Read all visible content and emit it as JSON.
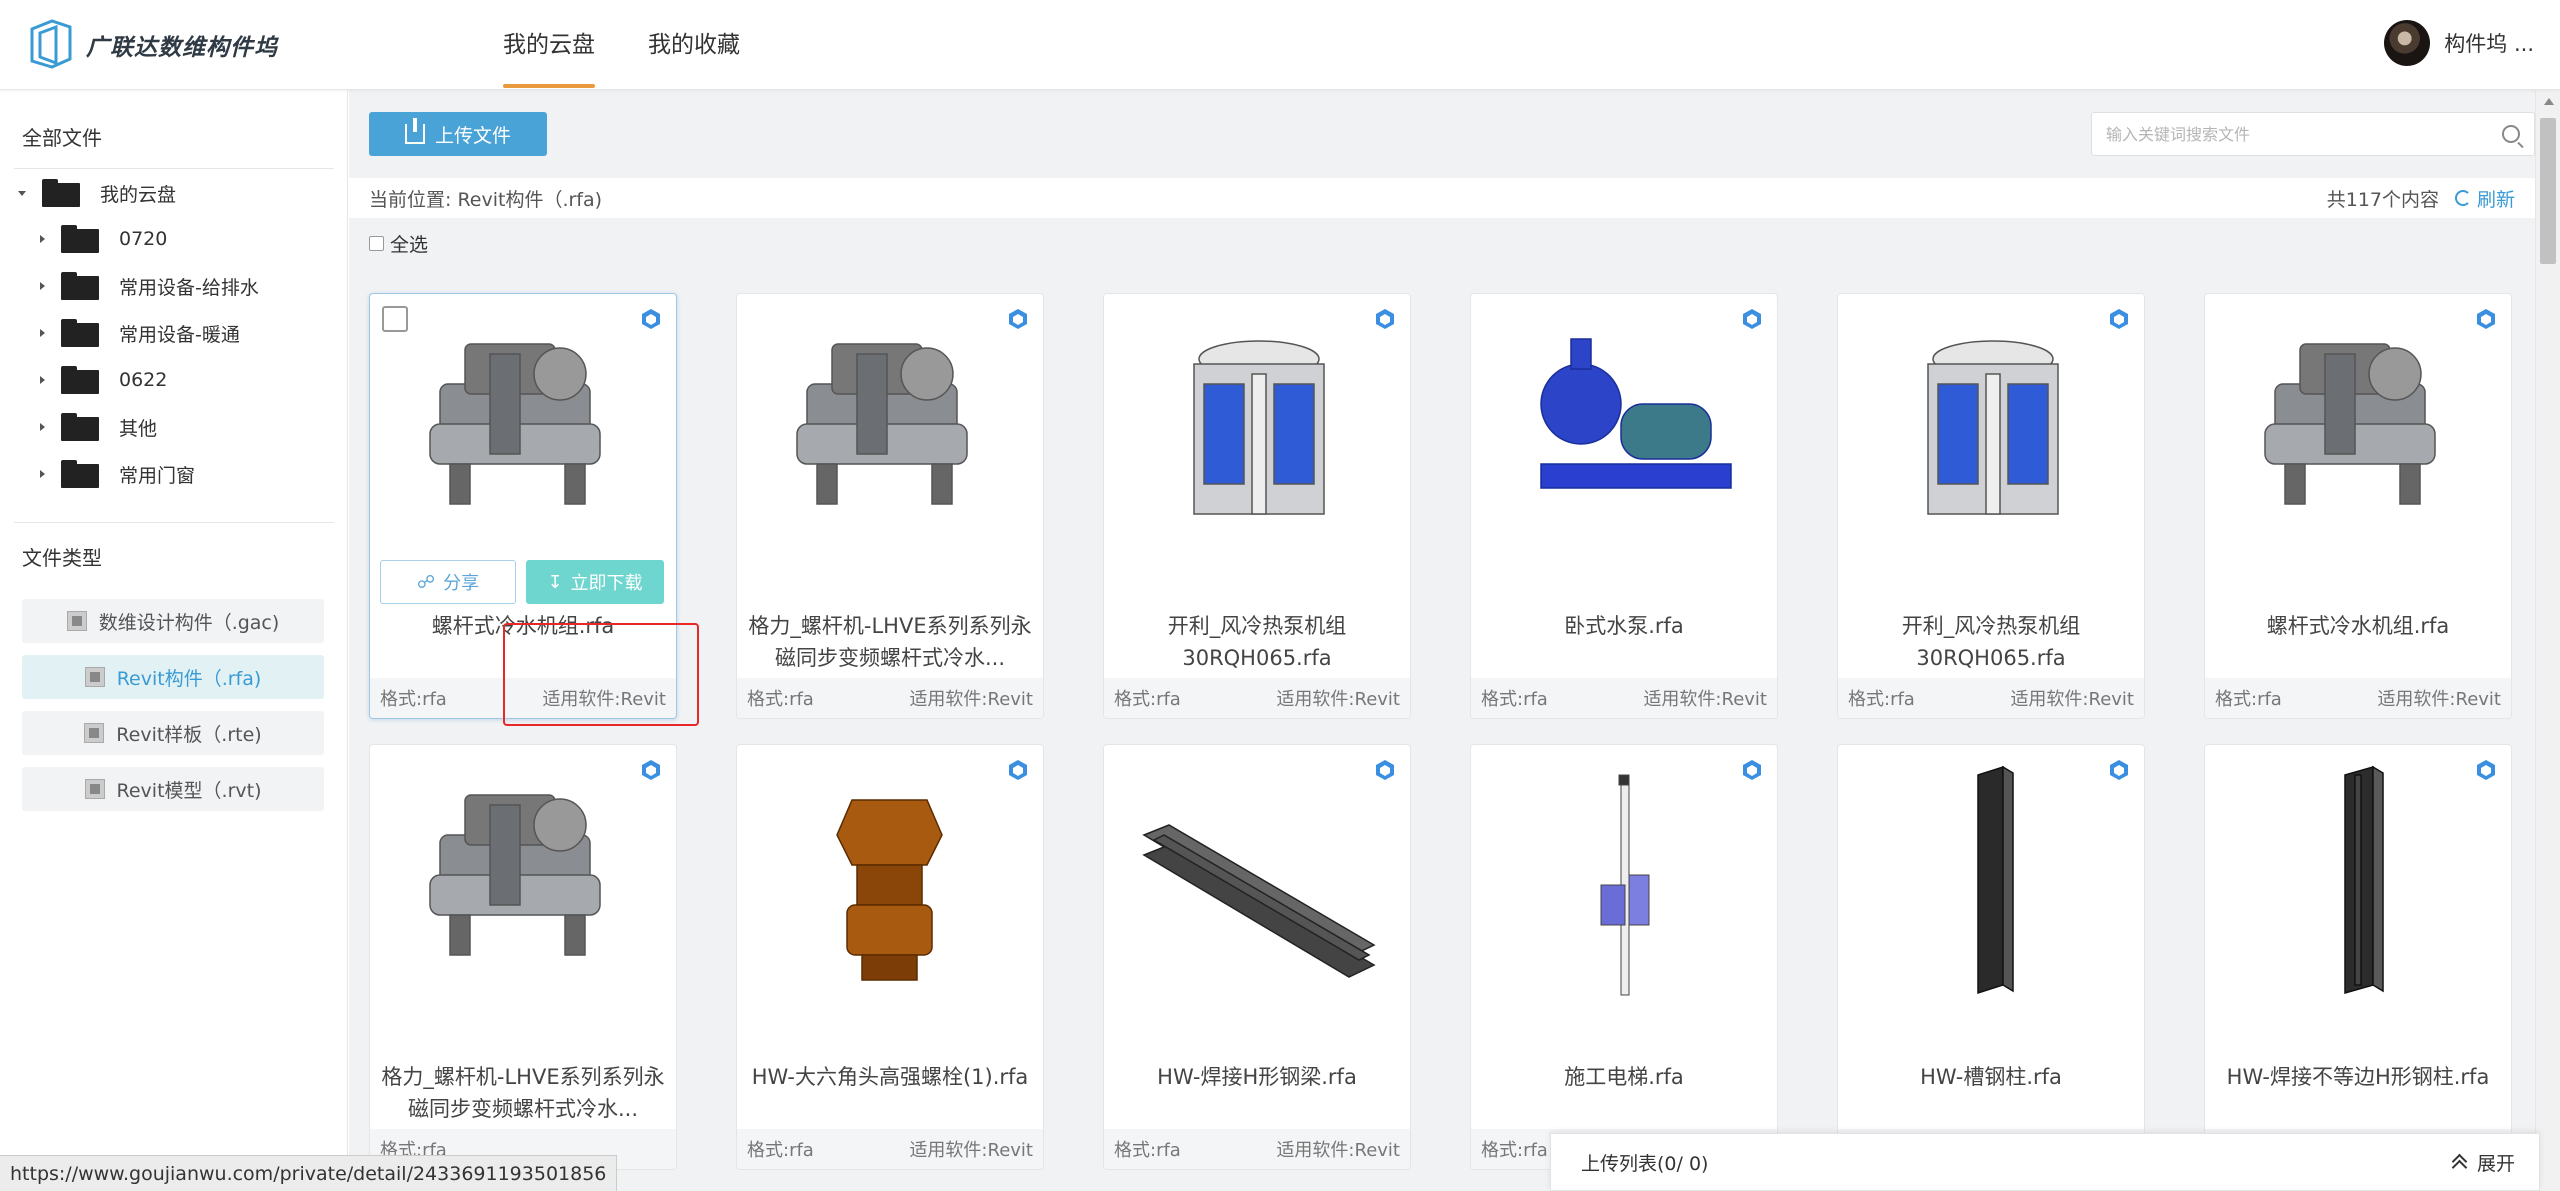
{
  "header": {
    "brand": "广联达数维构件坞",
    "tabs": [
      {
        "label": "我的云盘"
      },
      {
        "label": "我的收藏"
      }
    ],
    "user_name": "构件坞 ..."
  },
  "sidebar": {
    "all_files_title": "全部文件",
    "root": "我的云盘",
    "folders": [
      {
        "label": "0720"
      },
      {
        "label": "常用设备-给排水"
      },
      {
        "label": "常用设备-暖通"
      },
      {
        "label": "0622"
      },
      {
        "label": "其他"
      },
      {
        "label": "常用门窗"
      }
    ],
    "file_type_title": "文件类型",
    "types": [
      {
        "label": "数维设计构件（.gac)"
      },
      {
        "label": "Revit构件（.rfa)"
      },
      {
        "label": "Revit样板（.rte)"
      },
      {
        "label": "Revit模型（.rvt)"
      }
    ]
  },
  "toolbar": {
    "upload_label": "上传文件",
    "search_placeholder": "输入关键词搜索文件"
  },
  "breadcrumb": {
    "text": "当前位置:  Revit构件（.rfa)",
    "count": "共117个内容",
    "refresh": "刷新"
  },
  "select_all": "全选",
  "card_actions": {
    "share": "分享",
    "download": "立即下载"
  },
  "cards": [
    {
      "name": "螺杆式冷水机组.rfa",
      "format": "格式:rfa",
      "software": "适用软件:Revit",
      "thumb": "chiller"
    },
    {
      "name": "格力_螺杆机-LHVE系列系列永磁同步变频螺杆式冷水...",
      "format": "格式:rfa",
      "software": "适用软件:Revit",
      "thumb": "chiller"
    },
    {
      "name": "开利_风冷热泵机组30RQH065.rfa",
      "format": "格式:rfa",
      "software": "适用软件:Revit",
      "thumb": "heatpump"
    },
    {
      "name": "卧式水泵.rfa",
      "format": "格式:rfa",
      "software": "适用软件:Revit",
      "thumb": "pump"
    },
    {
      "name": "开利_风冷热泵机组30RQH065.rfa",
      "format": "格式:rfa",
      "software": "适用软件:Revit",
      "thumb": "heatpump"
    },
    {
      "name": "螺杆式冷水机组.rfa",
      "format": "格式:rfa",
      "software": "适用软件:Revit",
      "thumb": "chiller"
    },
    {
      "name": "格力_螺杆机-LHVE系列系列永磁同步变频螺杆式冷水...",
      "format": "格式:rfa",
      "software": "",
      "thumb": "chiller"
    },
    {
      "name": "HW-大六角头高强螺栓(1).rfa",
      "format": "格式:rfa",
      "software": "适用软件:Revit",
      "thumb": "bolt"
    },
    {
      "name": "HW-焊接H形钢梁.rfa",
      "format": "格式:rfa",
      "software": "适用软件:Revit",
      "thumb": "beam"
    },
    {
      "name": "施工电梯.rfa",
      "format": "格式:rfa",
      "software": "",
      "thumb": "elevator"
    },
    {
      "name": "HW-槽钢柱.rfa",
      "format": "",
      "software": "",
      "thumb": "column"
    },
    {
      "name": "HW-焊接不等边H形钢柱.rfa",
      "format": "",
      "software": "",
      "thumb": "column2"
    }
  ],
  "upload_list": {
    "label": "上传列表(0/ 0)",
    "expand": "展开"
  },
  "status_url": "https://www.goujianwu.com/private/detail/2433691193501856",
  "colors": {
    "accent": "#4aa3d6",
    "tab_underline": "#e89a3c",
    "download": "#6fd5cf",
    "highlight": "#e82828"
  }
}
